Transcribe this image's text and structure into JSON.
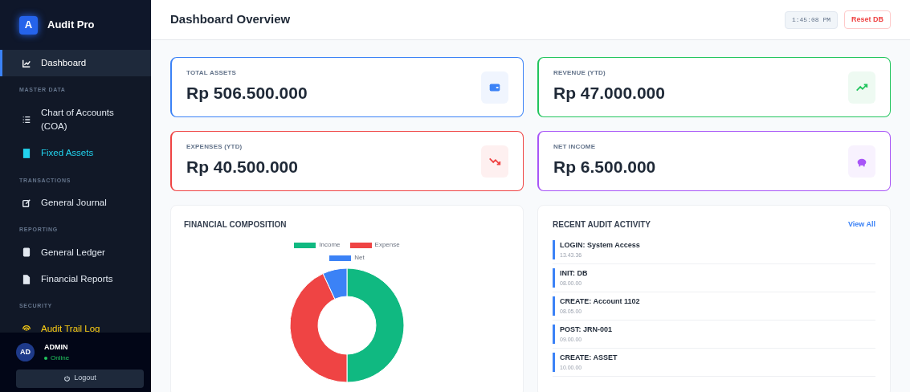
{
  "app": {
    "logo_letter": "A",
    "name": "Audit Pro"
  },
  "sidebar": {
    "items": [
      {
        "kind": "item",
        "label": "Dashboard",
        "selected": true
      },
      {
        "kind": "section",
        "label": "MASTER DATA"
      },
      {
        "kind": "item",
        "label": "Chart of Accounts (COA)",
        "selected": false
      },
      {
        "kind": "item",
        "label": "Fixed Assets",
        "selected": false,
        "color": "#22d3ee"
      },
      {
        "kind": "section",
        "label": "TRANSACTIONS"
      },
      {
        "kind": "item",
        "label": "General Journal",
        "selected": false
      },
      {
        "kind": "section",
        "label": "REPORTING"
      },
      {
        "kind": "item",
        "label": "General Ledger",
        "selected": false
      },
      {
        "kind": "item",
        "label": "Financial Reports",
        "selected": false
      },
      {
        "kind": "section",
        "label": "SECURITY"
      },
      {
        "kind": "item",
        "label": "Audit Trail Log",
        "selected": false,
        "color": "#facc15"
      }
    ]
  },
  "user": {
    "initials": "AD",
    "name": "ADMIN",
    "status": "Online",
    "logout": "Logout"
  },
  "header": {
    "title": "Dashboard Overview",
    "time": "1:45:08 PM",
    "reset": "Reset DB"
  },
  "stats": [
    {
      "label": "TOTAL ASSETS",
      "value": "Rp 506.500.000",
      "color": "#3b82f6"
    },
    {
      "label": "REVENUE (YTD)",
      "value": "Rp 47.000.000",
      "color": "#22c55e"
    },
    {
      "label": "EXPENSES (YTD)",
      "value": "Rp 40.500.000",
      "color": "#ef4444"
    },
    {
      "label": "NET INCOME",
      "value": "Rp 6.500.000",
      "color": "#a855f7"
    }
  ],
  "composition": {
    "title": "FINANCIAL COMPOSITION",
    "chart_data": {
      "type": "donut",
      "categories": [
        "Income",
        "Expense",
        "Net"
      ],
      "values": [
        50,
        43.1,
        6.9
      ],
      "legend": "top"
    }
  },
  "activity": {
    "title": "RECENT AUDIT ACTIVITY",
    "link": "View All",
    "items": [
      {
        "action": "LOGIN: System Access",
        "time": "13.43.36"
      },
      {
        "action": "INIT: DB",
        "time": "08.00.00"
      },
      {
        "action": "CREATE: Account 1102",
        "time": "08.05.00"
      },
      {
        "action": "POST: JRN-001",
        "time": "09.00.00"
      },
      {
        "action": "CREATE: ASSET",
        "time": "10.00.00"
      }
    ]
  }
}
